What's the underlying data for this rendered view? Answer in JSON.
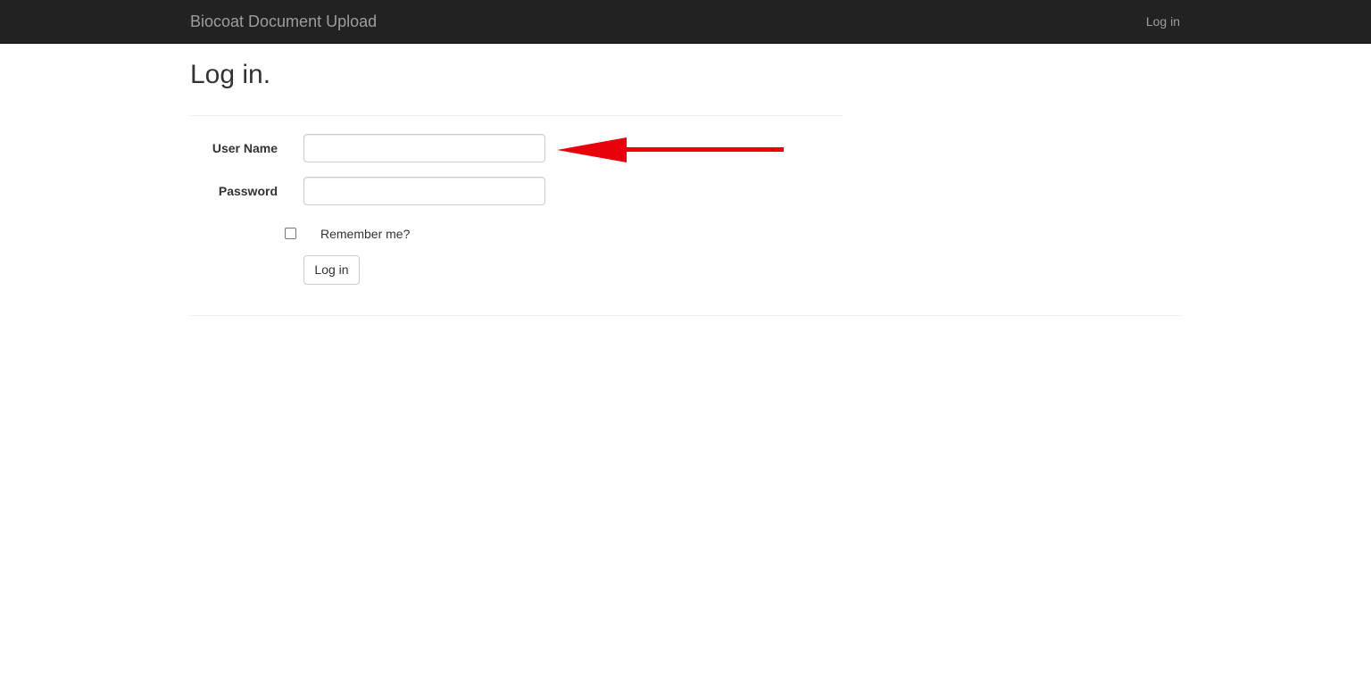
{
  "navbar": {
    "brand": "Biocoat Document Upload",
    "login_link": "Log in"
  },
  "page": {
    "title": "Log in."
  },
  "form": {
    "username_label": "User Name",
    "username_value": "",
    "password_label": "Password",
    "password_value": "",
    "remember_label": "Remember me?",
    "remember_checked": false,
    "submit_label": "Log in"
  },
  "annotation": {
    "arrow_color": "#e8000b",
    "icon": "arrow-left-icon"
  },
  "colors": {
    "navbar_bg": "#222222",
    "navbar_text": "#9d9d9d"
  }
}
